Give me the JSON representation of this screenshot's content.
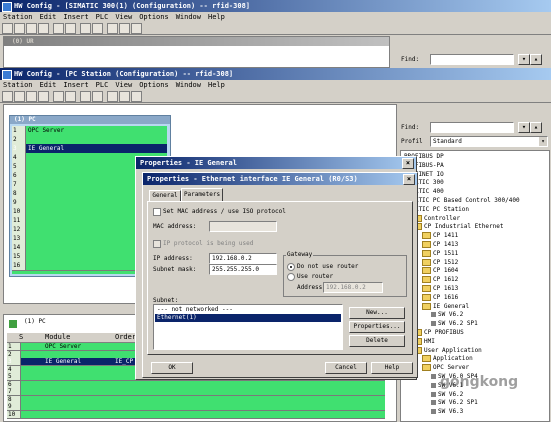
{
  "win1": {
    "title": "HW Config - [SIMATIC 300(1) (Configuration) -- rfid-308]",
    "menu": [
      "Station",
      "Edit",
      "Insert",
      "PLC",
      "View",
      "Options",
      "Window",
      "Help"
    ],
    "subtitle": "(0) UR",
    "find_label": "Find:"
  },
  "win2": {
    "title": "HW Config - [PC Station (Configuration) -- rfid-308]",
    "menu": [
      "Station",
      "Edit",
      "Insert",
      "PLC",
      "View",
      "Options",
      "Window",
      "Help"
    ],
    "rack_title": "(1) PC",
    "find_label": "Find:",
    "profile_label": "Profil",
    "profile_value": "Standard",
    "rack_rows": [
      {
        "n": "1",
        "name": "OPC Server"
      },
      {
        "n": "2",
        "name": ""
      },
      {
        "n": "3",
        "name": "IE General"
      },
      {
        "n": "4",
        "name": ""
      },
      {
        "n": "5",
        "name": ""
      },
      {
        "n": "6",
        "name": ""
      },
      {
        "n": "7",
        "name": ""
      },
      {
        "n": "8",
        "name": ""
      },
      {
        "n": "9",
        "name": ""
      },
      {
        "n": "10",
        "name": ""
      },
      {
        "n": "11",
        "name": ""
      },
      {
        "n": "12",
        "name": ""
      },
      {
        "n": "13",
        "name": ""
      },
      {
        "n": "14",
        "name": ""
      },
      {
        "n": "15",
        "name": ""
      },
      {
        "n": "16",
        "name": ""
      }
    ],
    "detail_title": "(1)  PC",
    "detail_headers": [
      "S",
      "Module",
      "Order"
    ],
    "detail_rows": [
      {
        "n": "1",
        "module": "OPC Server",
        "order": ""
      },
      {
        "n": "2",
        "module": "",
        "order": ""
      },
      {
        "n": "3",
        "module": "IE General",
        "order": "IE_CP"
      },
      {
        "n": "4",
        "module": "",
        "order": ""
      },
      {
        "n": "5",
        "module": "",
        "order": ""
      },
      {
        "n": "6",
        "module": "",
        "order": ""
      },
      {
        "n": "7",
        "module": "",
        "order": ""
      },
      {
        "n": "8",
        "module": "",
        "order": ""
      },
      {
        "n": "9",
        "module": "",
        "order": ""
      },
      {
        "n": "10",
        "module": "",
        "order": ""
      }
    ]
  },
  "catalog": [
    {
      "label": "PROFIBUS DP",
      "indent": 0,
      "folder": false
    },
    {
      "label": "PROFIBUS-PA",
      "indent": 0,
      "folder": false
    },
    {
      "label": "PROFINET IO",
      "indent": 0,
      "folder": false
    },
    {
      "label": "SIMATIC 300",
      "indent": 0,
      "folder": false
    },
    {
      "label": "SIMATIC 400",
      "indent": 0,
      "folder": false
    },
    {
      "label": "SIMATIC PC Based Control 300/400",
      "indent": 0,
      "folder": false
    },
    {
      "label": "SIMATIC PC Station",
      "indent": 0,
      "folder": false
    },
    {
      "label": "Controller",
      "indent": 1,
      "folder": true
    },
    {
      "label": "CP Industrial Ethernet",
      "indent": 1,
      "folder": true
    },
    {
      "label": "CP 1411",
      "indent": 2,
      "folder": true
    },
    {
      "label": "CP 1413",
      "indent": 2,
      "folder": true
    },
    {
      "label": "CP 1511",
      "indent": 2,
      "folder": true
    },
    {
      "label": "CP 1512",
      "indent": 2,
      "folder": true
    },
    {
      "label": "CP 1604",
      "indent": 2,
      "folder": true
    },
    {
      "label": "CP 1612",
      "indent": 2,
      "folder": true
    },
    {
      "label": "CP 1613",
      "indent": 2,
      "folder": true
    },
    {
      "label": "CP 1616",
      "indent": 2,
      "folder": true
    },
    {
      "label": "IE General",
      "indent": 2,
      "folder": true
    },
    {
      "label": "SW V6.2",
      "indent": 3,
      "folder": false
    },
    {
      "label": "SW V6.2 SP1",
      "indent": 3,
      "folder": false
    },
    {
      "label": "CP PROFIBUS",
      "indent": 1,
      "folder": true
    },
    {
      "label": "HMI",
      "indent": 1,
      "folder": true
    },
    {
      "label": "User Application",
      "indent": 1,
      "folder": true
    },
    {
      "label": "Application",
      "indent": 2,
      "folder": true
    },
    {
      "label": "OPC Server",
      "indent": 2,
      "folder": true
    },
    {
      "label": "SW V6.0 SP4",
      "indent": 3,
      "folder": false
    },
    {
      "label": "SW V6.1",
      "indent": 3,
      "folder": false
    },
    {
      "label": "SW V6.2",
      "indent": 3,
      "folder": false
    },
    {
      "label": "SW V6.2 SP1",
      "indent": 3,
      "folder": false
    },
    {
      "label": "SW V6.3",
      "indent": 3,
      "folder": false
    }
  ],
  "dlg_outer": {
    "title": "Properties - IE General"
  },
  "dlg": {
    "title": "Properties - Ethernet interface  IE General (R0/S3)",
    "tabs": [
      "General",
      "Parameters"
    ],
    "set_mac": "Set MAC address / use ISO protocol",
    "mac_label": "MAC address:",
    "ip_protocol": "IP protocol is being used",
    "ip_label": "IP address:",
    "ip_value": "192.168.0.2",
    "subnet_label": "Subnet mask:",
    "subnet_value": "255.255.255.0",
    "gateway_label": "Gateway",
    "no_router": "Do not use router",
    "use_router": "Use router",
    "address_label": "Address:",
    "address_value": "192.168.0.2",
    "subnet_list_label": "Subnet:",
    "subnet_items": [
      "--- not networked ---",
      "Ethernet(1)"
    ],
    "btn_new": "New...",
    "btn_properties": "Properties...",
    "btn_delete": "Delete",
    "btn_ok": "OK",
    "btn_cancel": "Cancel",
    "btn_help": "Help"
  },
  "watermark": "gongkong"
}
